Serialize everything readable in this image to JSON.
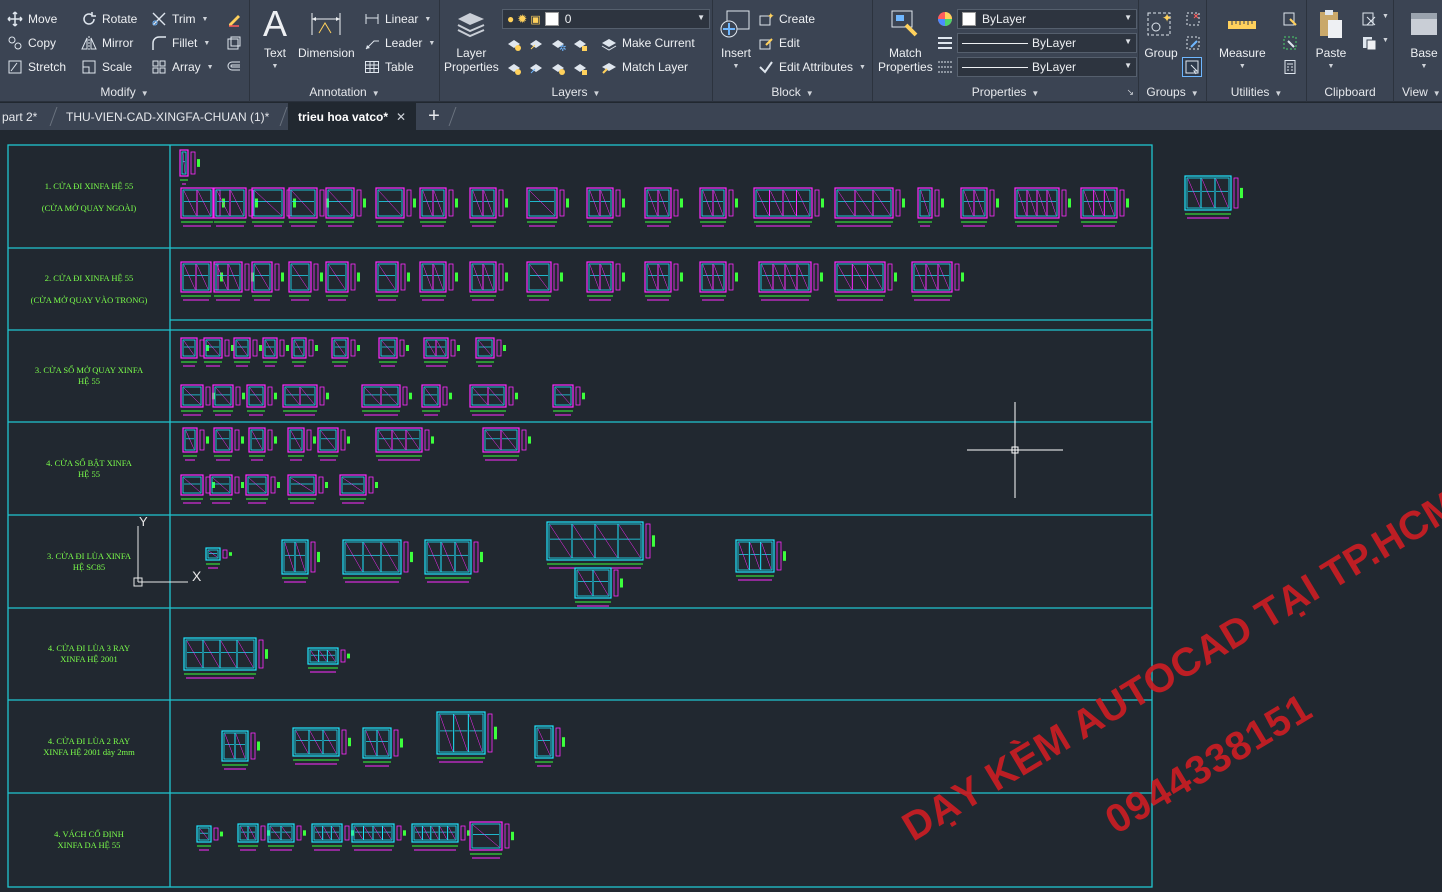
{
  "ribbon": {
    "modify": {
      "title": "Modify",
      "move": "Move",
      "rotate": "Rotate",
      "trim": "Trim",
      "copy": "Copy",
      "mirror": "Mirror",
      "fillet": "Fillet",
      "stretch": "Stretch",
      "scale": "Scale",
      "array": "Array"
    },
    "annotation": {
      "title": "Annotation",
      "text": "Text",
      "dimension": "Dimension",
      "linear": "Linear",
      "leader": "Leader",
      "table": "Table"
    },
    "layers": {
      "title": "Layers",
      "layer_properties_line1": "Layer",
      "layer_properties_line2": "Properties",
      "current_layer": "0",
      "make_current": "Make Current",
      "match_layer": "Match Layer"
    },
    "block": {
      "title": "Block",
      "insert": "Insert",
      "create": "Create",
      "edit": "Edit",
      "edit_attributes": "Edit Attributes"
    },
    "properties": {
      "title": "Properties",
      "match_line1": "Match",
      "match_line2": "Properties",
      "color": "ByLayer",
      "linetype": "ByLayer",
      "lineweight": "ByLayer"
    },
    "groups": {
      "title": "Groups",
      "group": "Group"
    },
    "utilities": {
      "title": "Utilities",
      "measure": "Measure"
    },
    "clipboard": {
      "title": "Clipboard",
      "paste": "Paste"
    },
    "view": {
      "title": "View",
      "base": "Base"
    }
  },
  "tabs": [
    {
      "label": "part 2*"
    },
    {
      "label": "THU-VIEN-CAD-XINGFA-CHUAN (1)*"
    },
    {
      "label": "trieu hoa vatco*",
      "active": true,
      "close": "✕"
    }
  ],
  "rows": [
    {
      "l1": "1. CỬA ĐI XINFA HỆ 55",
      "l2": "(CỬA MỞ QUAY NGOÀI)"
    },
    {
      "l1": "2. CỬA ĐI XINFA HỆ 55",
      "l2": "(CỬA MỞ QUAY VÀO TRONG)"
    },
    {
      "l1": "3. CỬA SỔ MỞ QUAY XINFA",
      "l2": "HỆ 55"
    },
    {
      "l1": "4. CỬA SỔ BẬT XINFA",
      "l2": "HỆ 55"
    },
    {
      "l1": "3. CỬA ĐI LÙA XINFA",
      "l2": "HỆ SC85"
    },
    {
      "l1": "4. CỬA ĐI LÙA 3 RAY",
      "l2": "XINFA HỆ 2001"
    },
    {
      "l1": "4. CỬA ĐI LÙA 2 RAY",
      "l2": "XINFA HỆ 2001 dày 2mm"
    },
    {
      "l1": "4. VÁCH CỐ ĐỊNH",
      "l2": "XINFA DA HỆ 55"
    }
  ],
  "ucs": {
    "x": "X",
    "y": "Y"
  },
  "watermark": {
    "line1": "DẠY KÈM AUTOCAD TẠI TP.HCM",
    "line2": "0944338151"
  },
  "colors": {
    "ribbon_bg": "#3b4453",
    "canvas_bg": "#212830",
    "grid_line": "#20c5cf",
    "label_text": "#7bff4b",
    "drawing_magenta": "#ff2bff",
    "drawing_cyan": "#1fe6ff",
    "drawing_green": "#3cff3c",
    "watermark": "#c91e24"
  }
}
